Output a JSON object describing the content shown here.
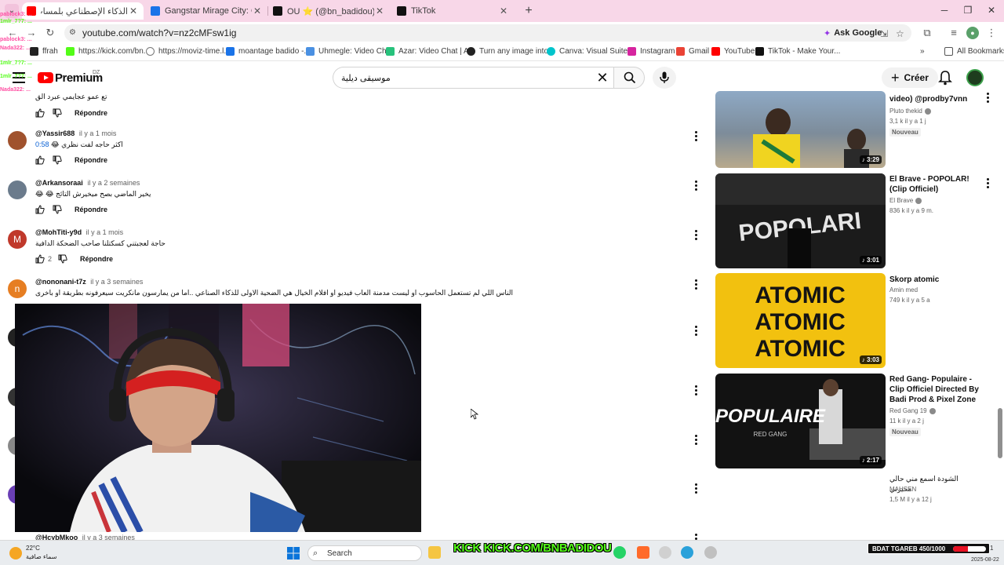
{
  "browser": {
    "tabs": [
      {
        "title": "الذكاء الإصطناعي بلمسات جزائرية",
        "color": "#ff0000",
        "active": true
      },
      {
        "title": "Gangstar Mirage City: Online Ap",
        "color": "#1a73e8",
        "active": false
      },
      {
        "title": "OU ⭐ (@bn_badidou) | TikTok",
        "color": "#111111",
        "active": false
      },
      {
        "title": "TikTok",
        "color": "#111111",
        "active": false
      }
    ],
    "url": "youtube.com/watch?v=nz2cMFsw1ig",
    "ask_google": "Ask Google",
    "bookmarks": [
      {
        "label": "ffrah",
        "color": "#222222"
      },
      {
        "label": "https://kick.com/bn...",
        "color": "#53fc18"
      },
      {
        "label": "https://moviz-time.l...",
        "color": "#777777"
      },
      {
        "label": "moantage badido -...",
        "color": "#1a73e8"
      },
      {
        "label": "Uhmegle: Video Ch...",
        "color": "#4a90e2"
      },
      {
        "label": "Azar: Video Chat | A...",
        "color": "#27c27c"
      },
      {
        "label": "Turn any image into...",
        "color": "#222222"
      },
      {
        "label": "Canva: Visual Suite...",
        "color": "#00c4cc"
      },
      {
        "label": "Instagram",
        "color": "#d6249f"
      },
      {
        "label": "Gmail",
        "color": "#ea4335"
      },
      {
        "label": "YouTube",
        "color": "#ff0000"
      },
      {
        "label": "TikTok - Make Your...",
        "color": "#111111"
      }
    ],
    "all_bookmarks": "All Bookmarks"
  },
  "youtube": {
    "brand": "Premium",
    "country": "DZ",
    "search_query": "موسيقى ديلية",
    "create_label": "Créer"
  },
  "comments": [
    {
      "user": "",
      "time": "",
      "text": "تع عمو عجايمي عبرد الق",
      "likes": "",
      "reply": "Répondre",
      "avatar_color": "",
      "letter": ""
    },
    {
      "user": "@Yassir688",
      "time": "il y a 1 mois",
      "text": "اكثر حاجه لفت نظري 😂",
      "timestamp": "0:58",
      "likes": "",
      "reply": "Répondre",
      "avatar_color": "#a0522d",
      "letter": ""
    },
    {
      "user": "@Arkansoraai",
      "time": "il y a 2 semaines",
      "text": "يخير الماضي بصح ميخيرش التائج 😂 😂",
      "likes": "",
      "reply": "Répondre",
      "avatar_color": "#6b7b8c",
      "letter": ""
    },
    {
      "user": "@MohTiti-y9d",
      "time": "il y a 1 mois",
      "text": "حاجة لعجبتني كسكتلنا صاحب الضحكة الدافية",
      "likes": "2",
      "reply": "Répondre",
      "avatar_color": "#c0392b",
      "letter": "M"
    },
    {
      "user": "@nononani-t7z",
      "time": "il y a 3 semaines",
      "text": "الناس اللي لم تستعمل الحاسوب او ليست مدمنة العاب فيديو او افلام الخيال هي الضحية الاولى للذكاء الصناعي ..اما من يمارسون مانكريت سيعرفونه بطريقة او باخرى",
      "likes": "",
      "reply": "",
      "avatar_color": "#e67e22",
      "letter": "n"
    },
    {
      "user": "@HcybMkoo",
      "time": "il y a 3 semaines",
      "text": "",
      "likes": "",
      "reply": "",
      "avatar_color": "",
      "letter": ""
    }
  ],
  "stream_chat": [
    {
      "text": "pablock3: ...",
      "color": "#ff4fa3"
    },
    {
      "text": "1mlr_7?7: ...",
      "color": "#53fc18"
    },
    {
      "text": "pablock3: ...",
      "color": "#ff4fa3"
    },
    {
      "text": "Nada322: ...",
      "color": "#ff4fa3"
    },
    {
      "text": "1mlr_7?7: ...",
      "color": "#53fc18"
    },
    {
      "text": "1mlr_7?7: ...",
      "color": "#53fc18"
    },
    {
      "text": "Nada322: ...",
      "color": "#ff4fa3"
    }
  ],
  "recommendations": [
    {
      "title": "video) @prodby7vnn",
      "channel": "Pluto thekid",
      "verified": true,
      "stats": "3,1 k   il y a 1 j",
      "badge": "Nouveau",
      "duration": "3:29",
      "thumb": "beach"
    },
    {
      "title": "El Brave - POPOLAR! (Clip Officiel)",
      "channel": "El Brave",
      "verified": true,
      "stats": "836 k   il y a 9 m.",
      "badge": "",
      "duration": "3:01",
      "thumb": "popolar"
    },
    {
      "title": "Skorp atomic",
      "channel": "Amin med",
      "verified": false,
      "stats": "749 k   il y a 5 a",
      "badge": "",
      "duration": "3:03",
      "thumb": "atomic"
    },
    {
      "title": "Red Gang- Populaire - Clip Officiel Directed By Badi Prod & Pixel Zone",
      "channel": "Red Gang 19",
      "verified": true,
      "stats": "11 k   il y a 2 j",
      "badge": "Nouveau",
      "duration": "2:17",
      "thumb": "populaire"
    },
    {
      "title": "الشودة اسمع مني حالي محيرني",
      "channel": "MAHSEN",
      "verified": false,
      "stats": "1,5 M   il y a 12 j",
      "badge": "",
      "duration": "",
      "thumb": ""
    }
  ],
  "thumb_text": {
    "popolar": "POPOLARI",
    "atomic": "ATOMIC",
    "populaire": "POPULAIRE",
    "populaire_sub": "RED GANG"
  },
  "taskbar": {
    "temp": "22°C",
    "weather": "سماء صافية",
    "search": "Search",
    "kick_logo": "KICK",
    "kick_url": "KICK.COM/BNBADIDOU",
    "goal_label": "BDAT TGAREB 450/1000",
    "goal_progress": 0.45,
    "date": "2025-08-22",
    "tray_num": "1"
  }
}
